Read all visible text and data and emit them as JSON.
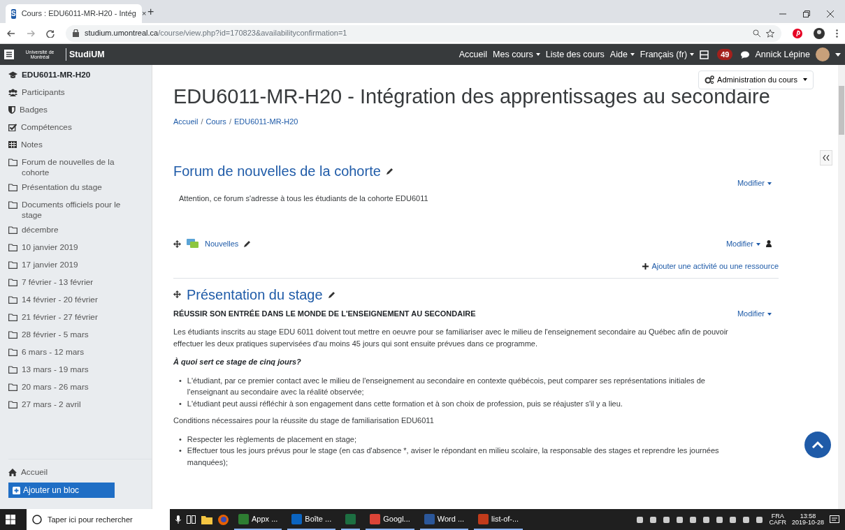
{
  "browser": {
    "favicon_letter": "S",
    "tab_title": "Cours : EDU6011-MR-H20 - Intég",
    "tab_close": "×",
    "new_tab": "+",
    "url_host": "studium.umontreal.ca",
    "url_path": "/course/view.php?id=170823&availabilityconfirmation=1"
  },
  "navbar": {
    "logo_text": "Université de Montréal",
    "brand": "StudiUM",
    "menu": [
      {
        "label": "Accueil",
        "dropdown": false
      },
      {
        "label": "Mes cours",
        "dropdown": true
      },
      {
        "label": "Liste des cours",
        "dropdown": false
      },
      {
        "label": "Aide",
        "dropdown": true
      },
      {
        "label": "Français (fr)",
        "dropdown": true
      }
    ],
    "notification_count": "49",
    "user": "Annick Lépine"
  },
  "sidebar": {
    "course": "EDU6011-MR-H20",
    "items": [
      {
        "label": "Participants",
        "kind": "users"
      },
      {
        "label": "Badges",
        "kind": "badges"
      },
      {
        "label": "Compétences",
        "kind": "competencies"
      },
      {
        "label": "Notes",
        "kind": "grades"
      },
      {
        "label": "Forum de nouvelles de la cohorte",
        "kind": "section"
      },
      {
        "label": "Présentation du stage",
        "kind": "section"
      },
      {
        "label": "Documents officiels pour le stage",
        "kind": "section"
      },
      {
        "label": "décembre",
        "kind": "section"
      },
      {
        "label": "10 janvier 2019",
        "kind": "section"
      },
      {
        "label": "17 janvier 2019",
        "kind": "section"
      },
      {
        "label": "7 février - 13 février",
        "kind": "section"
      },
      {
        "label": "14 février - 20 février",
        "kind": "section"
      },
      {
        "label": "21 février - 27 février",
        "kind": "section"
      },
      {
        "label": "28 février - 5 mars",
        "kind": "section"
      },
      {
        "label": "6 mars - 12 mars",
        "kind": "section"
      },
      {
        "label": "13 mars - 19 mars",
        "kind": "section"
      },
      {
        "label": "20 mars - 26 mars",
        "kind": "section"
      },
      {
        "label": "27 mars - 2 avril",
        "kind": "section"
      }
    ],
    "footer_item": "Accueil",
    "add_block": "Ajouter un bloc"
  },
  "main": {
    "admin_button": "Administration du cours",
    "title": "EDU6011-MR-H20 - Intégration des apprentissages au secondaire",
    "breadcrumb": {
      "links": [
        "Accueil",
        "Cours",
        "EDU6011-MR-H20"
      ],
      "separators": [
        "/",
        "/"
      ]
    },
    "sections": [
      {
        "title": "Forum de nouvelles de la cohorte",
        "edit_menu": "Modifier",
        "summary": [
          {
            "kind": "paragraph",
            "text": "Attention, ce forum s'adresse à tous les étudiants de la cohorte EDU6011"
          }
        ],
        "activities": [
          {
            "label": "Nouvelles",
            "edit_menu": "Modifier"
          }
        ],
        "add_activity": "Ajouter une activité ou une ressource"
      },
      {
        "title": "Présentation du stage",
        "edit_menu": "Modifier",
        "summary": [
          {
            "kind": "heading",
            "text": "RÉUSSIR SON ENTRÉE DANS LE MONDE DE L'ENSEIGNEMENT AU SECONDAIRE"
          },
          {
            "kind": "paragraph",
            "text": "Les étudiants inscrits au stage EDU 6011 doivent tout mettre en oeuvre pour se familiariser avec le milieu de l'enseignement secondaire au Québec afin de pouvoir effectuer les deux pratiques supervisées d'au moins 45 jours qui sont ensuite prévues dans ce programme."
          },
          {
            "kind": "question",
            "text": "À quoi sert ce stage de cinq jours?"
          },
          {
            "kind": "list",
            "bullet": "•",
            "items": [
              "L'étudiant, par ce premier contact avec le milieu de l'enseignement au secondaire en contexte québécois, peut comparer ses représentations initiales de l'enseignant au secondaire avec la réalité observée;",
              "L'étudiant peut aussi réfléchir à son engagement dans cette formation et à son choix de profession, puis se réajuster s'il y a lieu."
            ]
          },
          {
            "kind": "paragraph",
            "text": "Conditions nécessaires pour la réussite du stage de familiarisation EDU6011"
          },
          {
            "kind": "list",
            "bullet": "•",
            "items": [
              "Respecter les règlements de placement en stage;",
              "Effectuer tous les jours prévus pour le stage (en cas d'absence *, aviser le répondant en milieu scolaire, la responsable des stages et reprendre les journées manquées);"
            ]
          }
        ]
      }
    ]
  },
  "taskbar": {
    "search_placeholder": "Taper ici pour rechercher",
    "apps": [
      {
        "kind": "installer",
        "label": "Appx ..."
      },
      {
        "kind": "mail",
        "label": "Boîte ..."
      },
      {
        "kind": "spreadsheet"
      },
      {
        "kind": "browser",
        "label": "Googl..."
      },
      {
        "kind": "document",
        "label": "Word ..."
      },
      {
        "kind": "pdf",
        "label": "list-of-..."
      }
    ],
    "language": "FRA",
    "layout": "CAFR",
    "time": "13:58",
    "date": "2019-10-28"
  }
}
